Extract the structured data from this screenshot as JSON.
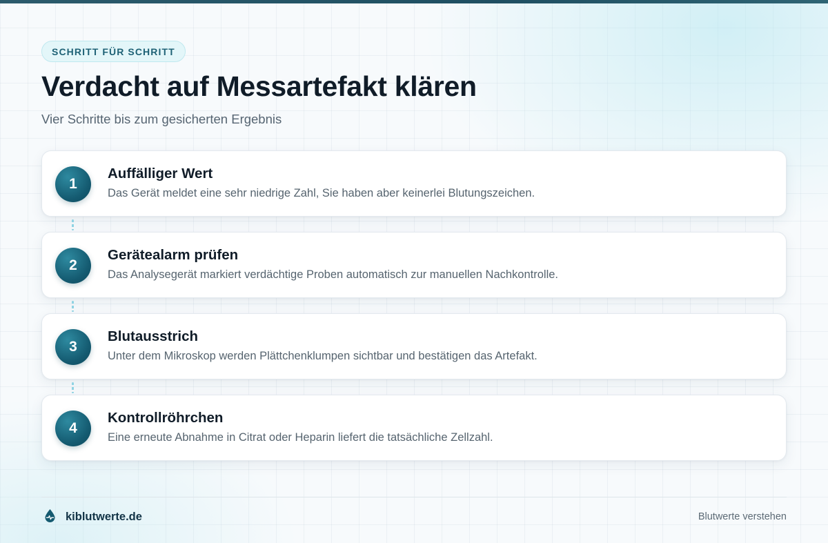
{
  "header": {
    "eyebrow": "SCHRITT FÜR SCHRITT",
    "title": "Verdacht auf Messartefakt klären",
    "subtitle": "Vier Schritte bis zum gesicherten Ergebnis"
  },
  "steps": [
    {
      "number": "1",
      "title": "Auffälliger Wert",
      "description": "Das Gerät meldet eine sehr niedrige Zahl, Sie haben aber keinerlei Blutungszeichen."
    },
    {
      "number": "2",
      "title": "Gerätealarm prüfen",
      "description": "Das Analysegerät markiert verdächtige Proben automatisch zur manuellen Nachkontrolle."
    },
    {
      "number": "3",
      "title": "Blutausstrich",
      "description": "Unter dem Mikroskop werden Plättchenklumpen sichtbar und bestätigen das Artefakt."
    },
    {
      "number": "4",
      "title": "Kontrollröhrchen",
      "description": "Eine erneute Abnahme in Citrat oder Heparin liefert die tatsächliche Zellzahl."
    }
  ],
  "footer": {
    "brand": "kiblutwerte.de",
    "brand_icon": "blood-drop-icon",
    "tagline": "Blutwerte verstehen"
  },
  "colors": {
    "accent": "#145a70",
    "connector": "#8fd3e3",
    "title": "#101c28",
    "text_muted": "#56646f"
  }
}
